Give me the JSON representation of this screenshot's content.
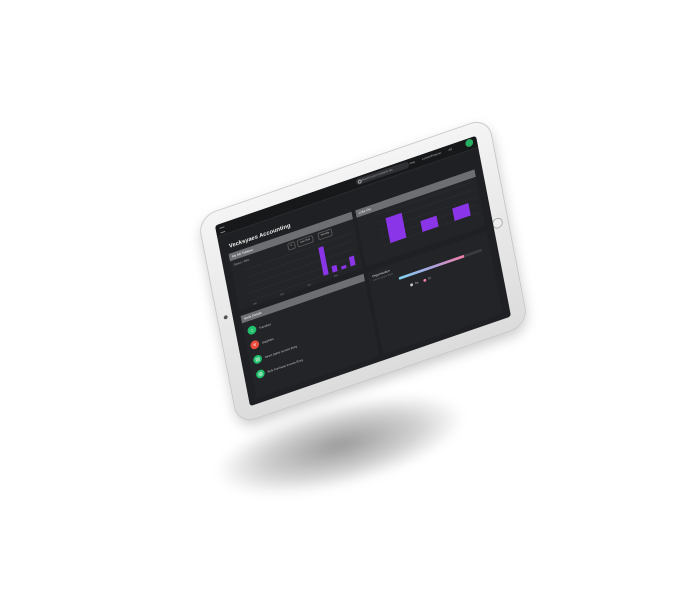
{
  "app": {
    "title": "Vecksyaes Accounting"
  },
  "topbar": {
    "search_placeholder": "Search your contacts etc",
    "items": [
      "Ons",
      "Lorem/Finance",
      "Ad"
    ]
  },
  "filter_panel": {
    "header": "My bill Tableau",
    "subtitle": "Status / Bills",
    "controls": [
      "C",
      "Last Year",
      "Monthly"
    ]
  },
  "secondary_panel": {
    "header": "Lnks Ort"
  },
  "bank_panel": {
    "header": "Bank Details",
    "items": [
      {
        "label": "Transfers",
        "icon": "bank-icon",
        "color": "#1fbf6b"
      },
      {
        "label": "Suppliers",
        "icon": "receipt-icon",
        "color": "#e74c3c"
      },
      {
        "label": "Direct Sales Invoice Entry",
        "icon": "document-icon",
        "color": "#1fbf6b"
      },
      {
        "label": "Bulk Purchase Invoice Entry",
        "icon": "document-icon",
        "color": "#1fbf6b"
      }
    ]
  },
  "org_panel": {
    "header": "Organisation",
    "subtitle": "Lorem ipsum dolor",
    "progress": 0.78,
    "legend": [
      {
        "label": "Sa",
        "color": "#cccccc"
      },
      {
        "label": "Dl",
        "color": "#f07fa8"
      }
    ]
  },
  "chart_data": [
    {
      "type": "bar",
      "title": "",
      "categories": [
        "Jan",
        "Feb",
        "Mar",
        "Apr",
        "May",
        "Jun",
        "Jul",
        "Aug",
        "Sep",
        "Oct",
        "Nov",
        "Dec"
      ],
      "values": [
        0,
        0,
        0,
        0,
        0,
        0,
        0,
        0,
        18,
        4,
        2,
        6
      ],
      "ylim": [
        0,
        20
      ],
      "color": "#8a35e8"
    },
    {
      "type": "bar",
      "title": "",
      "categories": [
        "A",
        "B",
        "C"
      ],
      "values": [
        16,
        7,
        8
      ],
      "ylim": [
        0,
        20
      ],
      "color": "#8a35e8"
    }
  ],
  "colors": {
    "accent": "#8a35e8",
    "background": "#1f2023"
  }
}
